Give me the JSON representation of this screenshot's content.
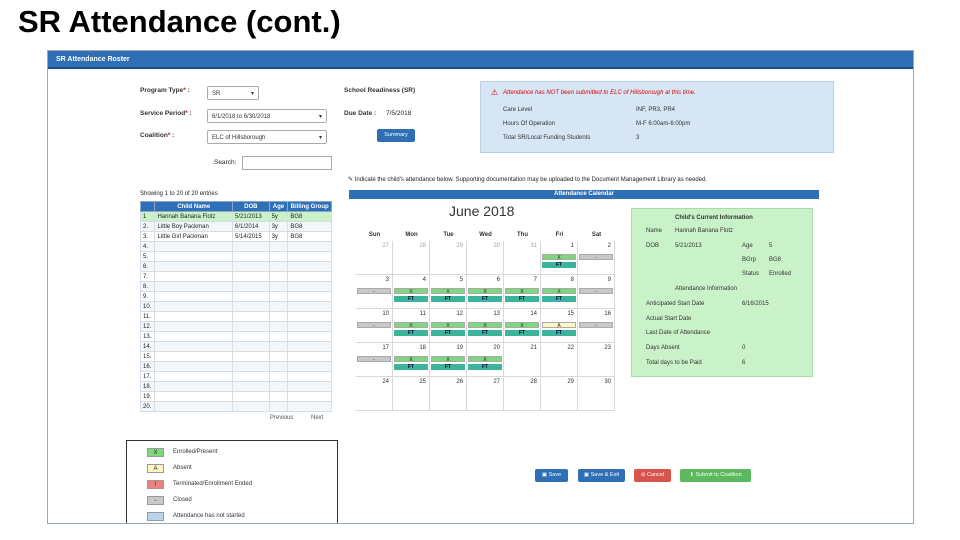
{
  "slide_title": "SR Attendance (cont.)",
  "header": {
    "title": "SR Attendance Roster"
  },
  "form": {
    "program_type_label": "Program Type",
    "program_type_value": "SR",
    "service_period_label": "Service Period",
    "service_period_value": "6/1/2018 to 6/30/2018",
    "coalition_label": "Coalition",
    "coalition_value": "ELC of Hillsborough",
    "search_label": "Search:",
    "school_readiness_label": "School Readiness (SR)",
    "due_date_label": "Due Date :",
    "due_date_value": "7/5/2018",
    "summary_button": "Summary"
  },
  "alert": {
    "message": "Attendance has NOT been submitted to ELC of Hillsborough at this time.",
    "rows": [
      {
        "label": "Care Level",
        "value": "INF, PR3, PR4"
      },
      {
        "label": "Hours Of Operation",
        "value": "M-F 6:00am-6:00pm"
      },
      {
        "label": "Total SR/Local Funding Students",
        "value": "3"
      }
    ]
  },
  "roster": {
    "showing": "Showing 1 to 20 of 20 entries",
    "columns": [
      "",
      "Child Name",
      "DOB",
      "Age",
      "Billing Group"
    ],
    "rows": [
      [
        "1",
        "Hannah Banana Flotz",
        "5/21/2013",
        "5y",
        "BG8"
      ],
      [
        "2.",
        "Little Boy Packman",
        "6/1/2014",
        "3y",
        "BG8"
      ],
      [
        "3.",
        "Little Girl Packman",
        "5/14/2015",
        "3y",
        "BG8"
      ],
      [
        "4.",
        "",
        "",
        "",
        ""
      ],
      [
        "5.",
        "",
        "",
        "",
        ""
      ],
      [
        "6.",
        "",
        "",
        "",
        ""
      ],
      [
        "7.",
        "",
        "",
        "",
        ""
      ],
      [
        "8.",
        "",
        "",
        "",
        ""
      ],
      [
        "9.",
        "",
        "",
        "",
        ""
      ],
      [
        "10.",
        "",
        "",
        "",
        ""
      ],
      [
        "11.",
        "",
        "",
        "",
        ""
      ],
      [
        "12.",
        "",
        "",
        "",
        ""
      ],
      [
        "13.",
        "",
        "",
        "",
        ""
      ],
      [
        "14.",
        "",
        "",
        "",
        ""
      ],
      [
        "15.",
        "",
        "",
        "",
        ""
      ],
      [
        "16.",
        "",
        "",
        "",
        ""
      ],
      [
        "17.",
        "",
        "",
        "",
        ""
      ],
      [
        "18.",
        "",
        "",
        "",
        ""
      ],
      [
        "19.",
        "",
        "",
        "",
        ""
      ],
      [
        "20.",
        "",
        "",
        "",
        ""
      ]
    ],
    "previous": "Previous",
    "next": "Next"
  },
  "calendar": {
    "instruction": "Indicate the child's attendance below. Supporting documentation may be uploaded to the Document Management Library as needed.",
    "bar_title": "Attendance Calendar",
    "month_label": "June 2018",
    "weekdays": [
      "Sun",
      "Mon",
      "Tue",
      "Wed",
      "Thu",
      "Fri",
      "Sat"
    ],
    "weeks": [
      [
        {
          "d": "27",
          "o": true
        },
        {
          "d": "28",
          "o": true
        },
        {
          "d": "29",
          "o": true
        },
        {
          "d": "30",
          "o": true
        },
        {
          "d": "31",
          "o": true
        },
        {
          "d": "1",
          "m": "X",
          "ft": true
        },
        {
          "d": "2",
          "m": "-"
        }
      ],
      [
        {
          "d": "3",
          "m": "-"
        },
        {
          "d": "4",
          "m": "X",
          "ft": true
        },
        {
          "d": "5",
          "m": "X",
          "ft": true
        },
        {
          "d": "6",
          "m": "X",
          "ft": true
        },
        {
          "d": "7",
          "m": "X",
          "ft": true
        },
        {
          "d": "8",
          "m": "X",
          "ft": true
        },
        {
          "d": "9",
          "m": "-"
        }
      ],
      [
        {
          "d": "10",
          "m": "-"
        },
        {
          "d": "11",
          "m": "X",
          "ft": true
        },
        {
          "d": "12",
          "m": "X",
          "ft": true
        },
        {
          "d": "13",
          "m": "X",
          "ft": true
        },
        {
          "d": "14",
          "m": "X",
          "ft": true
        },
        {
          "d": "15",
          "m": "A",
          "ft": true
        },
        {
          "d": "16",
          "m": "-"
        }
      ],
      [
        {
          "d": "17",
          "m": "-"
        },
        {
          "d": "18",
          "m": "X",
          "ft": true
        },
        {
          "d": "19",
          "m": "X",
          "ft": true
        },
        {
          "d": "20",
          "m": "X",
          "ft": true
        },
        {
          "d": "21"
        },
        {
          "d": "22"
        },
        {
          "d": "23"
        }
      ],
      [
        {
          "d": "24"
        },
        {
          "d": "25"
        },
        {
          "d": "26"
        },
        {
          "d": "27"
        },
        {
          "d": "28"
        },
        {
          "d": "29"
        },
        {
          "d": "30"
        }
      ]
    ],
    "ft_label": "FT"
  },
  "child_info": {
    "title": "Child's Current Information",
    "name_label": "Name",
    "name_value": "Hannah Banana Flotz",
    "dob_label": "DOB",
    "dob_value": "5/21/2013",
    "age_label": "Age",
    "age_value": "5",
    "bgrp_label": "BGrp",
    "bgrp_value": "BG8",
    "status_label": "Status",
    "status_value": "Enrolled",
    "attendance_info": "Attendance Information",
    "anticipated_start_label": "Anticipated Start Date",
    "anticipated_start_value": "6/16/2015",
    "actual_start_label": "Actual Start Date",
    "last_date_label": "Last Date of Attendance",
    "days_absent_label": "Days Absent",
    "days_absent_value": "0",
    "total_days_label": "Total days to be Paid",
    "total_days_value": "6"
  },
  "legend": [
    {
      "symbol": "X",
      "label": "Enrolled/Present",
      "color": "#7fd67f"
    },
    {
      "symbol": "A",
      "label": "Absent",
      "color": "#fff6c8"
    },
    {
      "symbol": "!",
      "label": "Terminated/Enrollment Ended",
      "color": "#f08080"
    },
    {
      "symbol": "-",
      "label": "Closed",
      "color": "#c8c8c8"
    },
    {
      "symbol": "",
      "label": "Attendance has not started",
      "color": "#b8d3ee"
    }
  ],
  "actions": {
    "save": "Save",
    "save_exit": "Save & Exit",
    "cancel": "Cancel",
    "submit": "Submit to Coalition"
  },
  "colors": {
    "header_blue": "#2f6fb5",
    "alert_bg": "#d6e6f5",
    "child_panel_bg": "#c9f2c9",
    "ft_teal": "#3cb39b",
    "selected_row": "#c9f2c9"
  }
}
